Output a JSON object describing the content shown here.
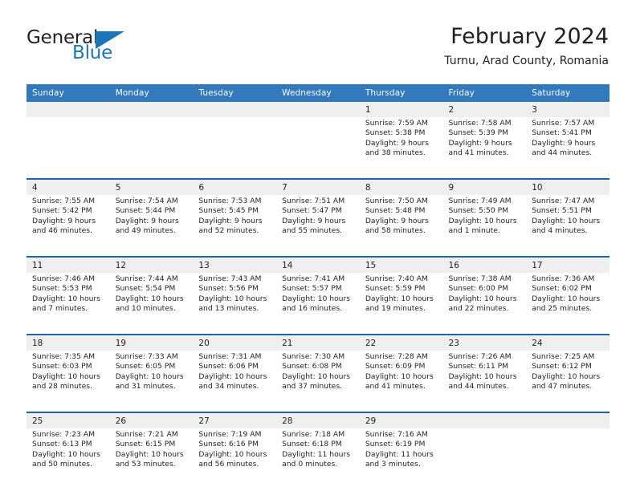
{
  "logo": {
    "text_general": "General",
    "text_blue": "Blue",
    "brand_dark": "#231f20",
    "brand_blue": "#1b75bb"
  },
  "header": {
    "title": "February 2024",
    "subtitle": "Turnu, Arad County, Romania"
  },
  "theme": {
    "header_blue": "#3279bd",
    "row_divider_blue": "#1f63a8",
    "daynum_band": "#efefef",
    "cell_bg": "#ffffff"
  },
  "calendar": {
    "weekday_headers": [
      "Sunday",
      "Monday",
      "Tuesday",
      "Wednesday",
      "Thursday",
      "Friday",
      "Saturday"
    ],
    "weeks": [
      [
        {
          "day": "",
          "lines": []
        },
        {
          "day": "",
          "lines": []
        },
        {
          "day": "",
          "lines": []
        },
        {
          "day": "",
          "lines": []
        },
        {
          "day": "1",
          "lines": [
            "Sunrise: 7:59 AM",
            "Sunset: 5:38 PM",
            "Daylight: 9 hours",
            "and 38 minutes."
          ]
        },
        {
          "day": "2",
          "lines": [
            "Sunrise: 7:58 AM",
            "Sunset: 5:39 PM",
            "Daylight: 9 hours",
            "and 41 minutes."
          ]
        },
        {
          "day": "3",
          "lines": [
            "Sunrise: 7:57 AM",
            "Sunset: 5:41 PM",
            "Daylight: 9 hours",
            "and 44 minutes."
          ]
        }
      ],
      [
        {
          "day": "4",
          "lines": [
            "Sunrise: 7:55 AM",
            "Sunset: 5:42 PM",
            "Daylight: 9 hours",
            "and 46 minutes."
          ]
        },
        {
          "day": "5",
          "lines": [
            "Sunrise: 7:54 AM",
            "Sunset: 5:44 PM",
            "Daylight: 9 hours",
            "and 49 minutes."
          ]
        },
        {
          "day": "6",
          "lines": [
            "Sunrise: 7:53 AM",
            "Sunset: 5:45 PM",
            "Daylight: 9 hours",
            "and 52 minutes."
          ]
        },
        {
          "day": "7",
          "lines": [
            "Sunrise: 7:51 AM",
            "Sunset: 5:47 PM",
            "Daylight: 9 hours",
            "and 55 minutes."
          ]
        },
        {
          "day": "8",
          "lines": [
            "Sunrise: 7:50 AM",
            "Sunset: 5:48 PM",
            "Daylight: 9 hours",
            "and 58 minutes."
          ]
        },
        {
          "day": "9",
          "lines": [
            "Sunrise: 7:49 AM",
            "Sunset: 5:50 PM",
            "Daylight: 10 hours",
            "and 1 minute."
          ]
        },
        {
          "day": "10",
          "lines": [
            "Sunrise: 7:47 AM",
            "Sunset: 5:51 PM",
            "Daylight: 10 hours",
            "and 4 minutes."
          ]
        }
      ],
      [
        {
          "day": "11",
          "lines": [
            "Sunrise: 7:46 AM",
            "Sunset: 5:53 PM",
            "Daylight: 10 hours",
            "and 7 minutes."
          ]
        },
        {
          "day": "12",
          "lines": [
            "Sunrise: 7:44 AM",
            "Sunset: 5:54 PM",
            "Daylight: 10 hours",
            "and 10 minutes."
          ]
        },
        {
          "day": "13",
          "lines": [
            "Sunrise: 7:43 AM",
            "Sunset: 5:56 PM",
            "Daylight: 10 hours",
            "and 13 minutes."
          ]
        },
        {
          "day": "14",
          "lines": [
            "Sunrise: 7:41 AM",
            "Sunset: 5:57 PM",
            "Daylight: 10 hours",
            "and 16 minutes."
          ]
        },
        {
          "day": "15",
          "lines": [
            "Sunrise: 7:40 AM",
            "Sunset: 5:59 PM",
            "Daylight: 10 hours",
            "and 19 minutes."
          ]
        },
        {
          "day": "16",
          "lines": [
            "Sunrise: 7:38 AM",
            "Sunset: 6:00 PM",
            "Daylight: 10 hours",
            "and 22 minutes."
          ]
        },
        {
          "day": "17",
          "lines": [
            "Sunrise: 7:36 AM",
            "Sunset: 6:02 PM",
            "Daylight: 10 hours",
            "and 25 minutes."
          ]
        }
      ],
      [
        {
          "day": "18",
          "lines": [
            "Sunrise: 7:35 AM",
            "Sunset: 6:03 PM",
            "Daylight: 10 hours",
            "and 28 minutes."
          ]
        },
        {
          "day": "19",
          "lines": [
            "Sunrise: 7:33 AM",
            "Sunset: 6:05 PM",
            "Daylight: 10 hours",
            "and 31 minutes."
          ]
        },
        {
          "day": "20",
          "lines": [
            "Sunrise: 7:31 AM",
            "Sunset: 6:06 PM",
            "Daylight: 10 hours",
            "and 34 minutes."
          ]
        },
        {
          "day": "21",
          "lines": [
            "Sunrise: 7:30 AM",
            "Sunset: 6:08 PM",
            "Daylight: 10 hours",
            "and 37 minutes."
          ]
        },
        {
          "day": "22",
          "lines": [
            "Sunrise: 7:28 AM",
            "Sunset: 6:09 PM",
            "Daylight: 10 hours",
            "and 41 minutes."
          ]
        },
        {
          "day": "23",
          "lines": [
            "Sunrise: 7:26 AM",
            "Sunset: 6:11 PM",
            "Daylight: 10 hours",
            "and 44 minutes."
          ]
        },
        {
          "day": "24",
          "lines": [
            "Sunrise: 7:25 AM",
            "Sunset: 6:12 PM",
            "Daylight: 10 hours",
            "and 47 minutes."
          ]
        }
      ],
      [
        {
          "day": "25",
          "lines": [
            "Sunrise: 7:23 AM",
            "Sunset: 6:13 PM",
            "Daylight: 10 hours",
            "and 50 minutes."
          ]
        },
        {
          "day": "26",
          "lines": [
            "Sunrise: 7:21 AM",
            "Sunset: 6:15 PM",
            "Daylight: 10 hours",
            "and 53 minutes."
          ]
        },
        {
          "day": "27",
          "lines": [
            "Sunrise: 7:19 AM",
            "Sunset: 6:16 PM",
            "Daylight: 10 hours",
            "and 56 minutes."
          ]
        },
        {
          "day": "28",
          "lines": [
            "Sunrise: 7:18 AM",
            "Sunset: 6:18 PM",
            "Daylight: 11 hours",
            "and 0 minutes."
          ]
        },
        {
          "day": "29",
          "lines": [
            "Sunrise: 7:16 AM",
            "Sunset: 6:19 PM",
            "Daylight: 11 hours",
            "and 3 minutes."
          ]
        },
        {
          "day": "",
          "lines": []
        },
        {
          "day": "",
          "lines": []
        }
      ]
    ]
  }
}
